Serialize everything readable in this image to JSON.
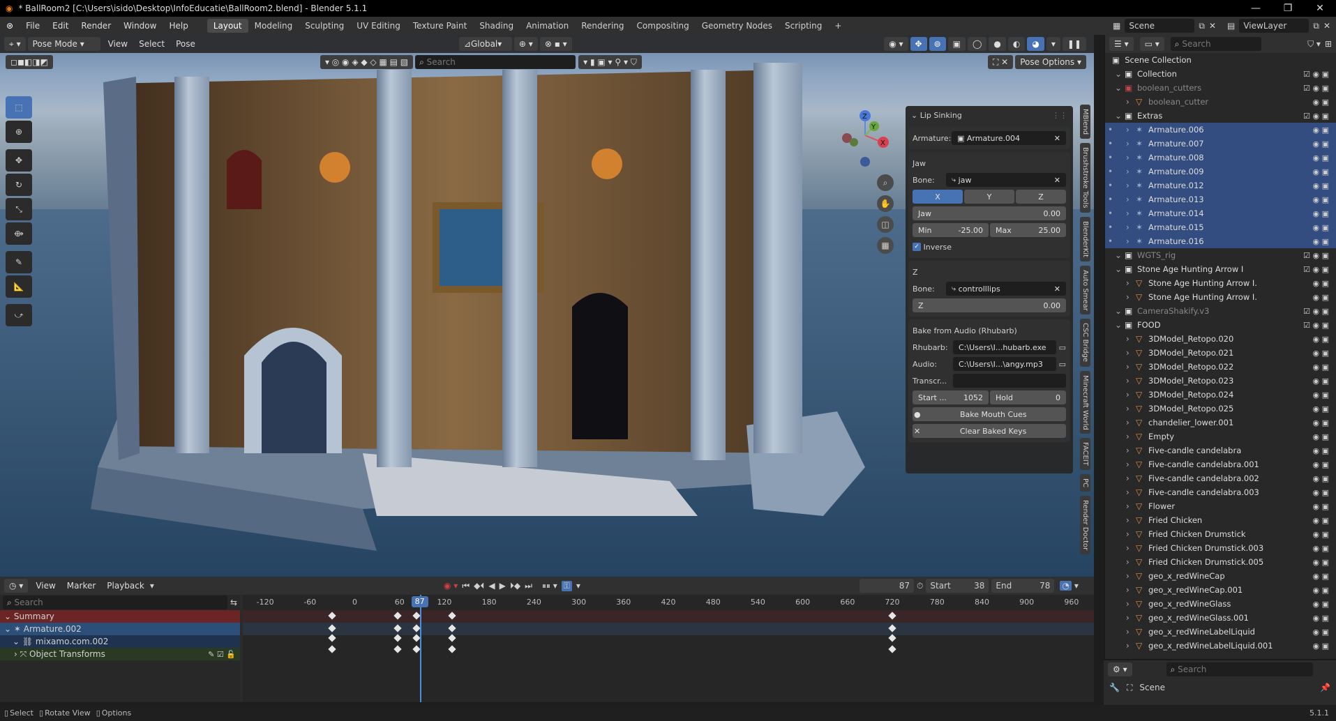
{
  "window": {
    "title": "* BallRoom2 [C:\\Users\\isido\\Desktop\\InfoEducatie\\BallRoom2.blend] - Blender 5.1.1"
  },
  "menu": [
    "File",
    "Edit",
    "Render",
    "Window",
    "Help"
  ],
  "workspaces": [
    "Layout",
    "Modeling",
    "Sculpting",
    "UV Editing",
    "Texture Paint",
    "Shading",
    "Animation",
    "Rendering",
    "Compositing",
    "Geometry Nodes",
    "Scripting"
  ],
  "active_workspace": "Layout",
  "scene": {
    "name": "Scene",
    "view_layer": "ViewLayer"
  },
  "viewport": {
    "mode": "Pose Mode",
    "menus": [
      "View",
      "Select",
      "Pose"
    ],
    "orientation": "Global",
    "search_placeholder": "Search",
    "pose_options": "Pose Options",
    "side_tabs": [
      "MBlend",
      "Brushstroke Tools",
      "BlenderKit",
      "Auto Smear",
      "CSC Bridge",
      "Minecraft World",
      "FACEIT",
      "PC",
      "Render Doctor"
    ]
  },
  "gizmo": {
    "x": "X",
    "y": "Y",
    "z": "Z"
  },
  "lip_panel": {
    "title": "Lip Sinking",
    "armature_label": "Armature:",
    "armature": "Armature.004",
    "jaw_header": "Jaw",
    "bone_label": "Bone:",
    "jaw_bone": "jaw",
    "axes": [
      "X",
      "Y",
      "Z"
    ],
    "jaw_field": "Jaw",
    "jaw_value": "0.00",
    "min_label": "Min",
    "min_value": "-25.00",
    "max_label": "Max",
    "max_value": "25.00",
    "inverse": "Inverse",
    "z_header": "Z",
    "z_bone": "controlllips",
    "z_field": "Z",
    "z_value": "0.00",
    "bake_header": "Bake from Audio (Rhubarb)",
    "rhubarb_label": "Rhubarb:",
    "rhubarb": "C:\\Users\\I...hubarb.exe",
    "audio_label": "Audio:",
    "audio": "C:\\Users\\I...\\angy.mp3",
    "transcr_label": "Transcr...",
    "start_label": "Start ...",
    "start_value": "1052",
    "hold_label": "Hold",
    "hold_value": "0",
    "bake_btn": "Bake Mouth Cues",
    "clear_btn": "Clear Baked Keys"
  },
  "timeline": {
    "menus": [
      "View",
      "Marker",
      "Playback"
    ],
    "current_frame": "87",
    "start_label": "Start",
    "start": "38",
    "end_label": "End",
    "end": "78",
    "search_placeholder": "Search",
    "ticks": [
      "-120",
      "-60",
      "0",
      "60",
      "120",
      "180",
      "240",
      "300",
      "360",
      "420",
      "480",
      "540",
      "600",
      "660",
      "720",
      "780",
      "840",
      "900",
      "960"
    ],
    "channels": [
      "Summary",
      "Armature.002",
      "mixamo.com.002",
      "Object Transforms"
    ],
    "keyframes": [
      -30,
      57,
      83,
      130,
      720
    ]
  },
  "outliner": {
    "search_placeholder": "Search",
    "root": "Scene Collection",
    "rows": [
      {
        "name": "Collection",
        "indent": 1,
        "type": "coll",
        "sel": false
      },
      {
        "name": "boolean_cutters",
        "indent": 1,
        "type": "coll-red",
        "sel": false,
        "dim": true
      },
      {
        "name": "boolean_cutter",
        "indent": 2,
        "type": "mesh",
        "sel": false,
        "dim": true
      },
      {
        "name": "Extras",
        "indent": 1,
        "type": "coll",
        "sel": false
      },
      {
        "name": "Armature.006",
        "indent": 2,
        "type": "arm",
        "sel": true
      },
      {
        "name": "Armature.007",
        "indent": 2,
        "type": "arm",
        "sel": true
      },
      {
        "name": "Armature.008",
        "indent": 2,
        "type": "arm",
        "sel": true
      },
      {
        "name": "Armature.009",
        "indent": 2,
        "type": "arm",
        "sel": true
      },
      {
        "name": "Armature.012",
        "indent": 2,
        "type": "arm",
        "sel": true
      },
      {
        "name": "Armature.013",
        "indent": 2,
        "type": "arm",
        "sel": true
      },
      {
        "name": "Armature.014",
        "indent": 2,
        "type": "arm",
        "sel": true
      },
      {
        "name": "Armature.015",
        "indent": 2,
        "type": "arm",
        "sel": true
      },
      {
        "name": "Armature.016",
        "indent": 2,
        "type": "arm",
        "sel": true
      },
      {
        "name": "WGTS_rig",
        "indent": 1,
        "type": "coll",
        "sel": false,
        "dim": true
      },
      {
        "name": "Stone Age Hunting Arrow I",
        "indent": 1,
        "type": "coll",
        "sel": false
      },
      {
        "name": "Stone Age Hunting Arrow I.",
        "indent": 2,
        "type": "mesh",
        "sel": false
      },
      {
        "name": "Stone Age Hunting Arrow I.",
        "indent": 2,
        "type": "mesh",
        "sel": false
      },
      {
        "name": "CameraShakify.v3",
        "indent": 1,
        "type": "coll",
        "sel": false,
        "dim": true
      },
      {
        "name": "FOOD",
        "indent": 1,
        "type": "coll",
        "sel": false
      },
      {
        "name": "3DModel_Retopo.020",
        "indent": 2,
        "type": "mesh",
        "sel": false
      },
      {
        "name": "3DModel_Retopo.021",
        "indent": 2,
        "type": "mesh",
        "sel": false
      },
      {
        "name": "3DModel_Retopo.022",
        "indent": 2,
        "type": "mesh",
        "sel": false
      },
      {
        "name": "3DModel_Retopo.023",
        "indent": 2,
        "type": "mesh",
        "sel": false
      },
      {
        "name": "3DModel_Retopo.024",
        "indent": 2,
        "type": "mesh",
        "sel": false
      },
      {
        "name": "3DModel_Retopo.025",
        "indent": 2,
        "type": "mesh",
        "sel": false
      },
      {
        "name": "chandelier_lower.001",
        "indent": 2,
        "type": "mesh",
        "sel": false
      },
      {
        "name": "Empty",
        "indent": 2,
        "type": "mesh",
        "sel": false
      },
      {
        "name": "Five-candle candelabra",
        "indent": 2,
        "type": "mesh",
        "sel": false
      },
      {
        "name": "Five-candle candelabra.001",
        "indent": 2,
        "type": "mesh",
        "sel": false
      },
      {
        "name": "Five-candle candelabra.002",
        "indent": 2,
        "type": "mesh",
        "sel": false
      },
      {
        "name": "Five-candle candelabra.003",
        "indent": 2,
        "type": "mesh",
        "sel": false
      },
      {
        "name": "Flower",
        "indent": 2,
        "type": "mesh",
        "sel": false
      },
      {
        "name": "Fried Chicken",
        "indent": 2,
        "type": "mesh",
        "sel": false
      },
      {
        "name": "Fried Chicken Drumstick",
        "indent": 2,
        "type": "mesh",
        "sel": false
      },
      {
        "name": "Fried Chicken Drumstick.003",
        "indent": 2,
        "type": "mesh",
        "sel": false
      },
      {
        "name": "Fried Chicken Drumstick.005",
        "indent": 2,
        "type": "mesh",
        "sel": false
      },
      {
        "name": "geo_x_redWineCap",
        "indent": 2,
        "type": "mesh",
        "sel": false
      },
      {
        "name": "geo_x_redWineCap.001",
        "indent": 2,
        "type": "mesh",
        "sel": false
      },
      {
        "name": "geo_x_redWineGlass",
        "indent": 2,
        "type": "mesh",
        "sel": false
      },
      {
        "name": "geo_x_redWineGlass.001",
        "indent": 2,
        "type": "mesh",
        "sel": false
      },
      {
        "name": "geo_x_redWineLabelLiquid",
        "indent": 2,
        "type": "mesh",
        "sel": false
      },
      {
        "name": "geo_x_redWineLabelLiquid.001",
        "indent": 2,
        "type": "mesh",
        "sel": false
      }
    ]
  },
  "properties": {
    "search_placeholder": "Search",
    "scene": "Scene"
  },
  "status": {
    "select": "Select",
    "rotate": "Rotate View",
    "options": "Options",
    "version": "5.1.1"
  },
  "colors": {
    "accent": "#4772b3",
    "selection": "#334d80",
    "header": "#303030"
  }
}
